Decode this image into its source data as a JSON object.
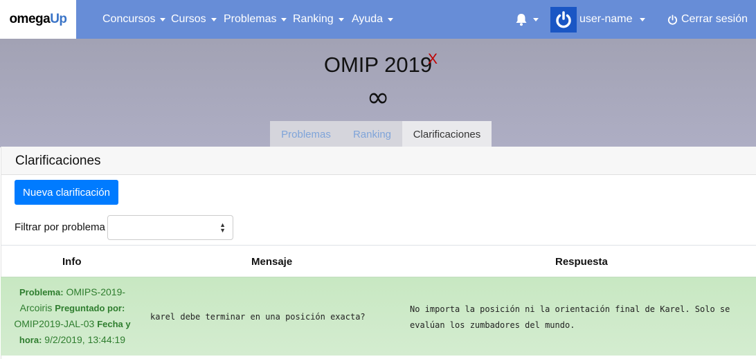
{
  "nav": {
    "logo_omega": "omega",
    "logo_up": "Up",
    "items": [
      {
        "label": "Concursos"
      },
      {
        "label": "Cursos"
      },
      {
        "label": "Problemas"
      },
      {
        "label": "Ranking"
      },
      {
        "label": "Ayuda"
      }
    ],
    "username": "user-name",
    "logout": "Cerrar sesión",
    "icons": {
      "bell": "bell-icon",
      "logout": "power-icon",
      "avatar": "omegaup-user-icon"
    }
  },
  "contest": {
    "title": "OMIP 2019",
    "title_mark": "X",
    "time_remaining": "∞",
    "tabs": [
      {
        "label": "Problemas",
        "active": false
      },
      {
        "label": "Ranking",
        "active": false
      },
      {
        "label": "Clarificaciones",
        "active": true
      }
    ]
  },
  "clarifications": {
    "heading": "Clarificaciones",
    "new_button": "Nueva clarificación",
    "filter_label": "Filtrar por problema",
    "filter_value": "",
    "columns": [
      "Info",
      "Mensaje",
      "Respuesta"
    ],
    "rows": [
      {
        "problema_label": "Problema:",
        "problema": "OMIPS-2019-Arcoiris",
        "preguntado_label": "Preguntado por:",
        "preguntado": "OMIP2019-JAL-03",
        "fecha_label": "Fecha y hora:",
        "fecha": "9/2/2019, 13:44:19",
        "mensaje": "karel debe terminar en una posición exacta?",
        "respuesta_line1": "No importa la posición ni la orientación final de Karel. Solo se",
        "respuesta_line2": "evalúan los zumbadores del mundo."
      }
    ]
  },
  "colors": {
    "navbar": "#678dd7",
    "primary_button": "#007bff",
    "answered_row": "#c8e8c2",
    "title_mark": "#c00000"
  }
}
